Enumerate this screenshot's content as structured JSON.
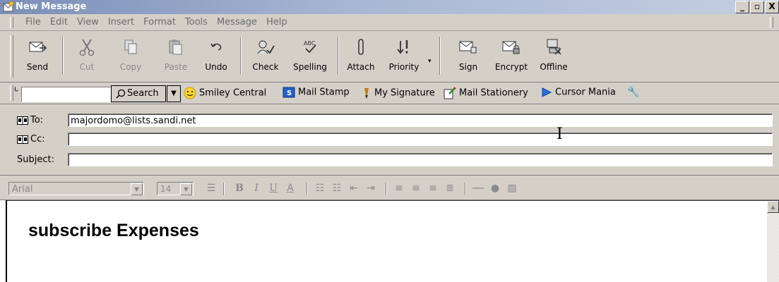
{
  "window": {
    "title": "New Message",
    "buttons": [
      "_",
      "3",
      "X"
    ]
  },
  "menu": [
    "File",
    "Edit",
    "View",
    "Insert",
    "Format",
    "Tools",
    "Message",
    "Help"
  ],
  "toolbar": [
    {
      "label": "Send",
      "icon": "send-icon",
      "enabled": true
    },
    {
      "label": "Cut",
      "icon": "scissors-icon",
      "enabled": false
    },
    {
      "label": "Copy",
      "icon": "copy-icon",
      "enabled": false
    },
    {
      "label": "Paste",
      "icon": "paste-icon",
      "enabled": false
    },
    {
      "label": "Undo",
      "icon": "undo-icon",
      "enabled": true
    },
    {
      "label": "Check",
      "icon": "check-names-icon",
      "enabled": true
    },
    {
      "label": "Spelling",
      "icon": "spelling-icon",
      "enabled": true
    },
    {
      "label": "Attach",
      "icon": "paperclip-icon",
      "enabled": true
    },
    {
      "label": "Priority",
      "icon": "priority-icon",
      "enabled": true
    },
    {
      "label": "Sign",
      "icon": "sign-icon",
      "enabled": true
    },
    {
      "label": "Encrypt",
      "icon": "encrypt-icon",
      "enabled": true
    },
    {
      "label": "Offline",
      "icon": "offline-icon",
      "enabled": true
    }
  ],
  "linkbar": {
    "search_value": "",
    "search_label": "Search",
    "links": [
      {
        "label": "Smiley Central",
        "icon": "smiley-icon"
      },
      {
        "label": "Mail Stamp",
        "icon": "stamp-icon"
      },
      {
        "label": "My Signature",
        "icon": "signature-icon"
      },
      {
        "label": "Mail Stationery",
        "icon": "stationery-icon"
      },
      {
        "label": "Cursor Mania",
        "icon": "cursor-icon"
      }
    ]
  },
  "header": {
    "to_label": "To:",
    "to_value": "majordomo@lists.sandi.net",
    "cc_label": "Cc:",
    "cc_value": "",
    "subject_label": "Subject:",
    "subject_value": ""
  },
  "format": {
    "font": "Arial",
    "size": "14"
  },
  "body": {
    "text": "subscribe Expenses"
  },
  "colors": {
    "titlebar": "#7b8fb8",
    "chrome": "#d4d0c8"
  }
}
